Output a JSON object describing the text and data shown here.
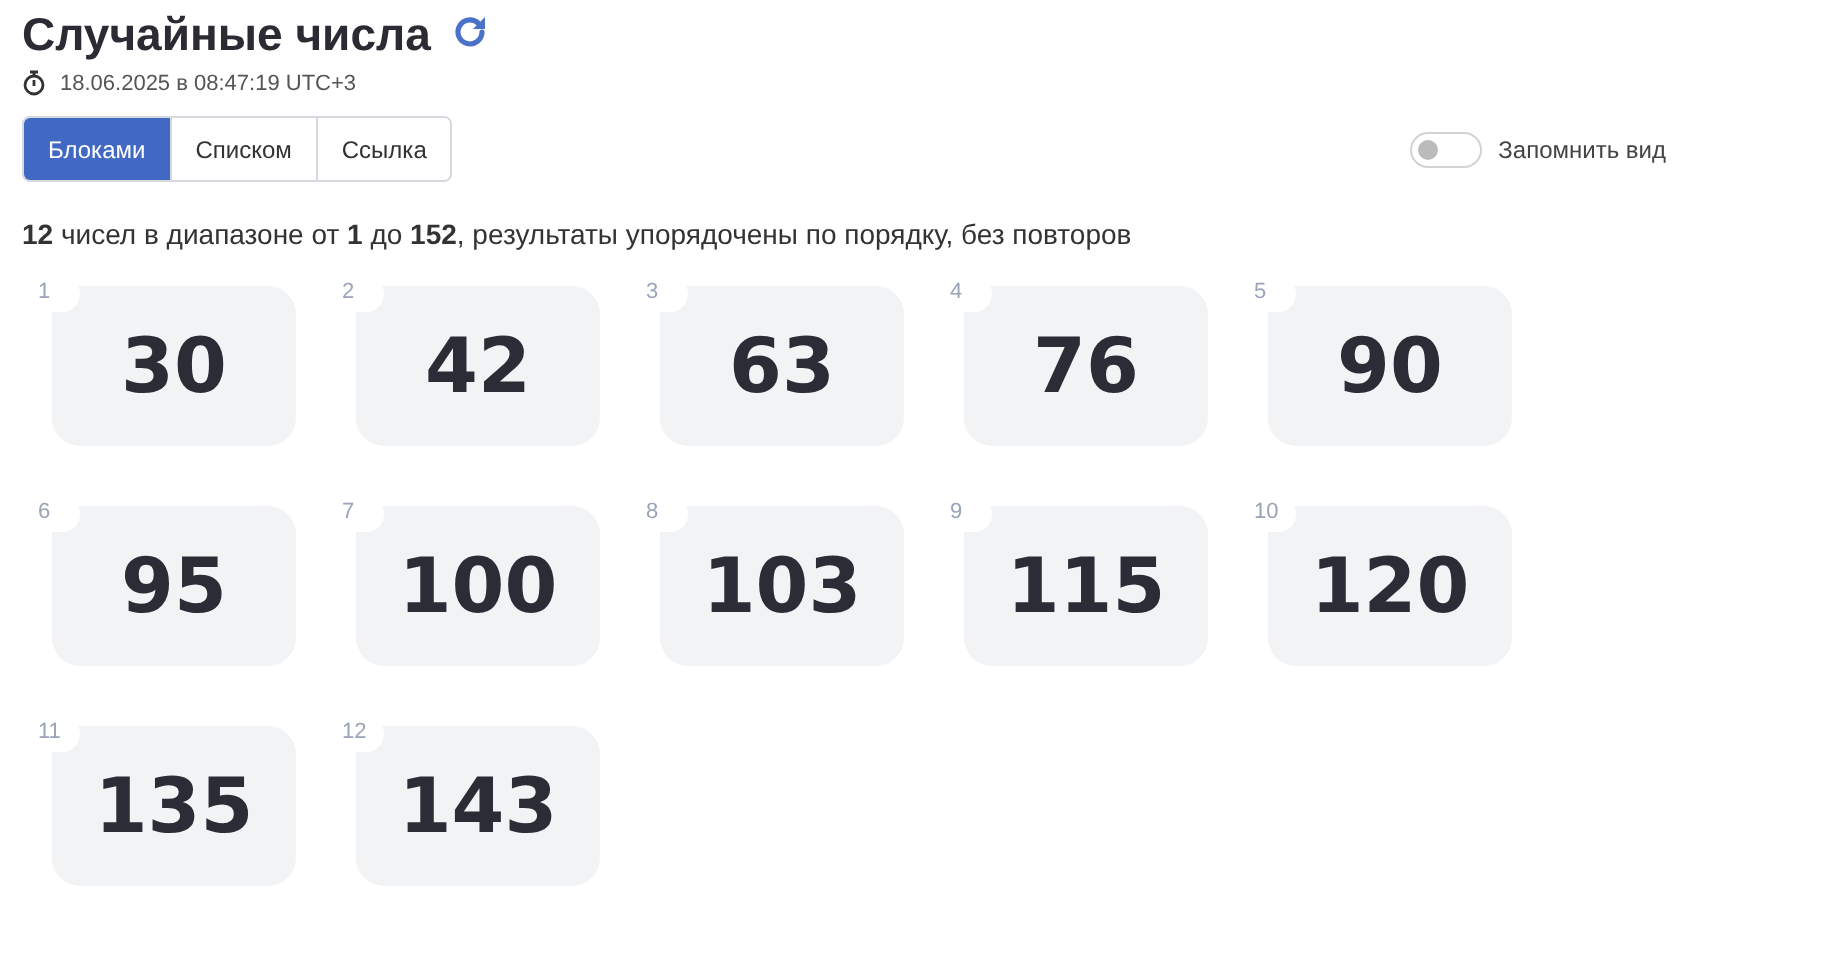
{
  "title": "Случайные числа",
  "timestamp": "18.06.2025 в 08:47:19 UTC+3",
  "tabs": [
    {
      "label": "Блоками",
      "selected": true
    },
    {
      "label": "Списком",
      "selected": false
    },
    {
      "label": "Ссылка",
      "selected": false
    }
  ],
  "remember_view": {
    "label": "Запомнить вид",
    "on": false
  },
  "summary": "**12** чисел в диапазоне от **1** до **152**, результаты упорядочены по порядку, без повторов",
  "numbers": [
    {
      "index": "1",
      "value": "30"
    },
    {
      "index": "2",
      "value": "42"
    },
    {
      "index": "3",
      "value": "63"
    },
    {
      "index": "4",
      "value": "76"
    },
    {
      "index": "5",
      "value": "90"
    },
    {
      "index": "6",
      "value": "95"
    },
    {
      "index": "7",
      "value": "100"
    },
    {
      "index": "8",
      "value": "103"
    },
    {
      "index": "9",
      "value": "115"
    },
    {
      "index": "10",
      "value": "120"
    },
    {
      "index": "11",
      "value": "135"
    },
    {
      "index": "12",
      "value": "143"
    }
  ]
}
